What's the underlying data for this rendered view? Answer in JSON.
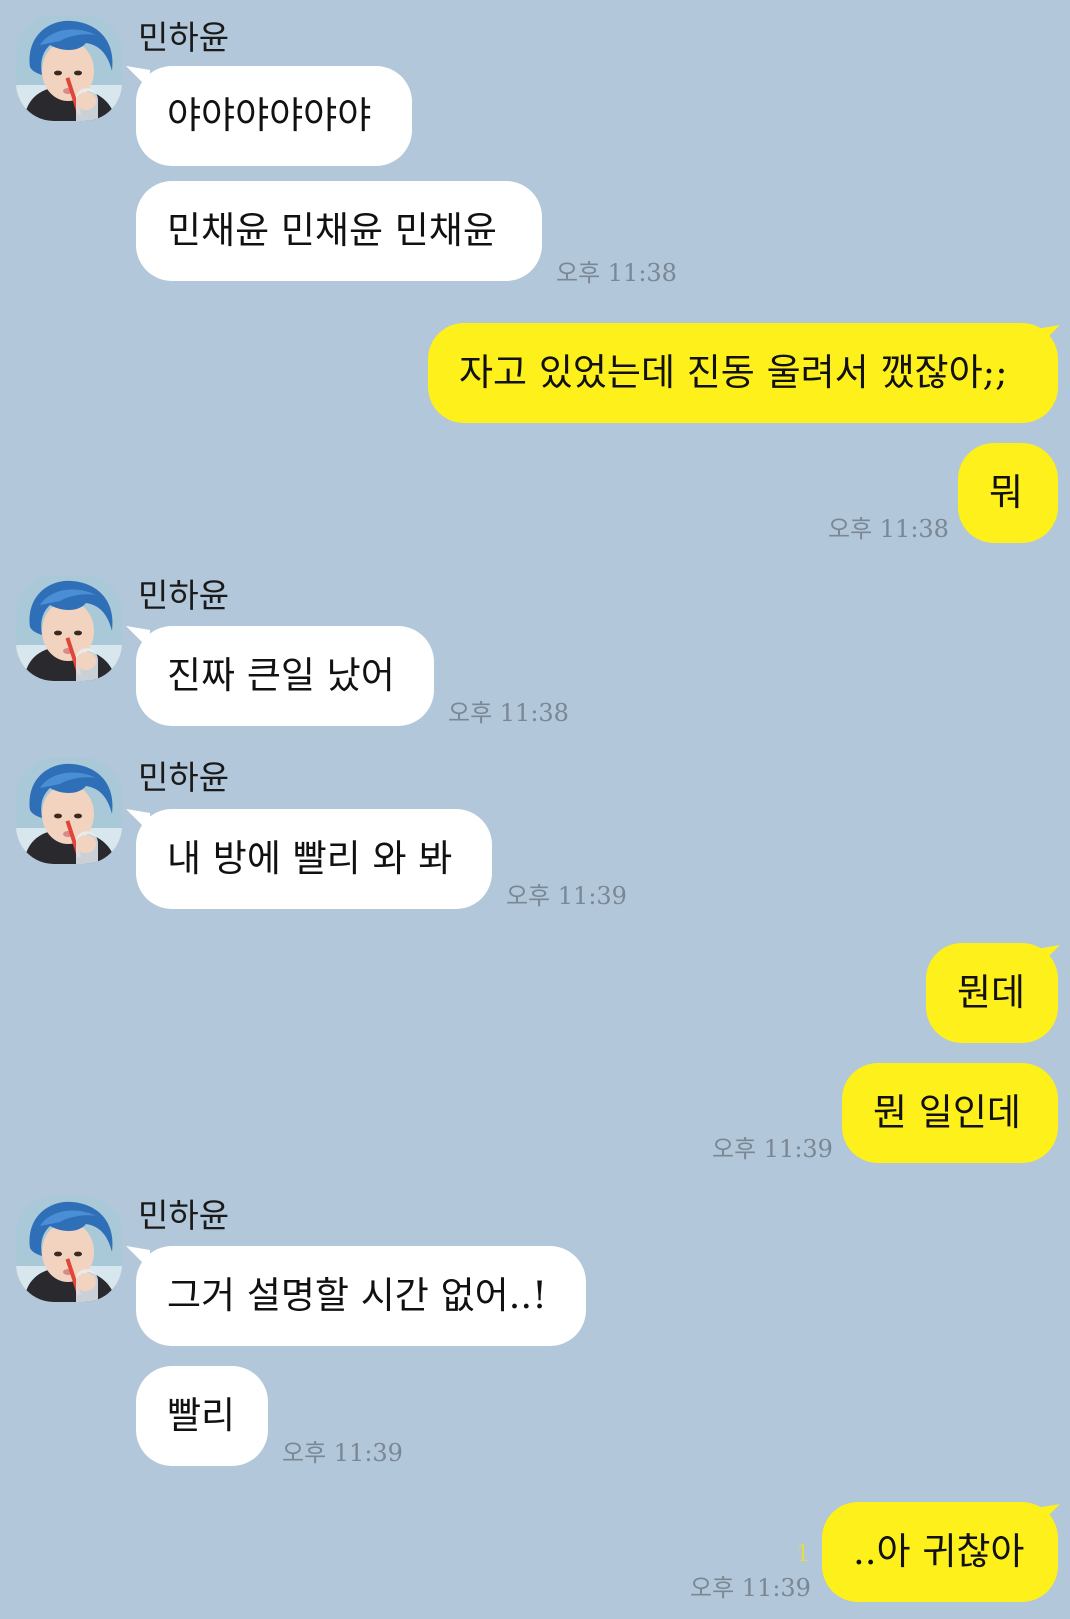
{
  "sender": {
    "name": "민하윤",
    "avatar_icon": "profile-photo-icon"
  },
  "messages": {
    "m1": "야야야야야야",
    "m2": "민채윤 민채윤 민채윤",
    "t1": "오후 11:38",
    "m3": "자고 있었는데 진동 울려서 깼잖아;;",
    "m4": "뭐",
    "t2": "오후 11:38",
    "m5": "진짜 큰일 났어",
    "t3": "오후 11:38",
    "m6": "내 방에 빨리 와 봐",
    "t4": "오후 11:39",
    "m7": "뭔데",
    "m8": "뭔 일인데",
    "t5": "오후 11:39",
    "m9": "그거 설명할 시간 없어..!",
    "m10": "빨리",
    "t6": "오후 11:39",
    "m11": "..아 귀찮아",
    "unread": "1",
    "t7": "오후 11:39"
  },
  "colors": {
    "background": "#b2c7d9",
    "incoming_bubble": "#ffffff",
    "outgoing_bubble": "#fef01b",
    "timestamp": "#7a8794",
    "unread": "#e8d84a"
  }
}
